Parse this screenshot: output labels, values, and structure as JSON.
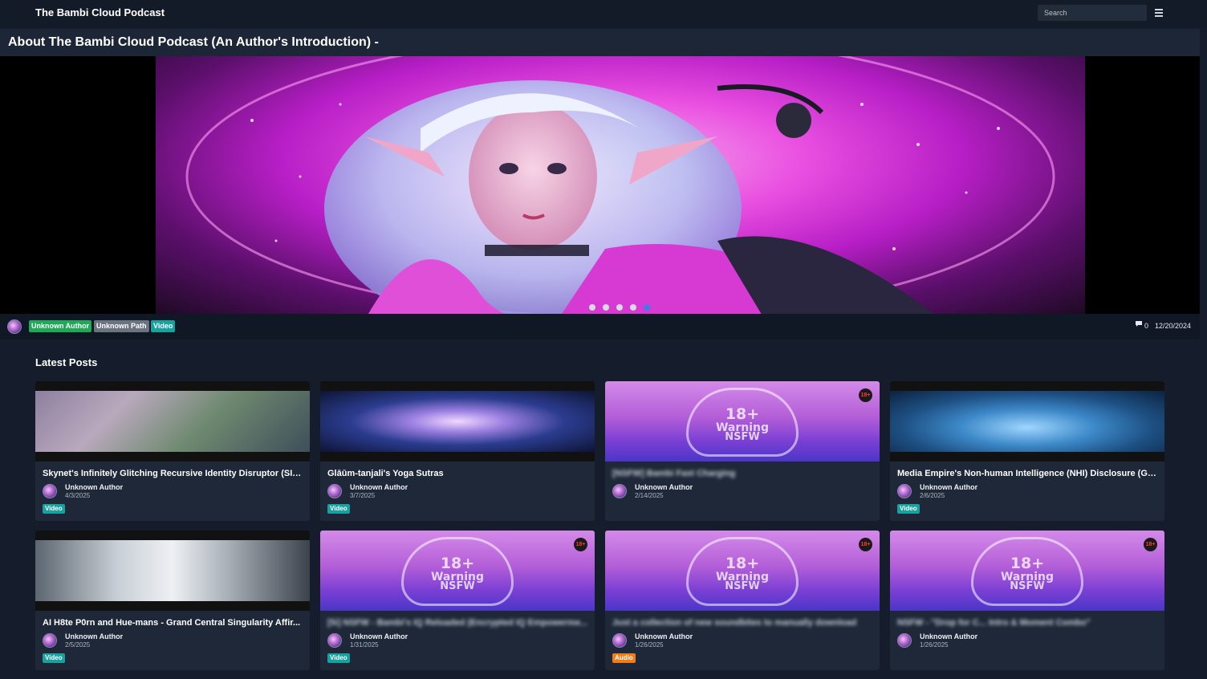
{
  "header": {
    "site_title": "The Bambi Cloud Podcast",
    "search_placeholder": "Search",
    "menu_icon": "hamburger-icon"
  },
  "featured": {
    "title": "About The Bambi Cloud Podcast (An Author's Introduction) -",
    "carousel_dots": 5,
    "active_dot": 5,
    "tags": [
      "Unknown Author",
      "Unknown Path",
      "Video"
    ],
    "comment_count": "0",
    "date": "12/20/2024"
  },
  "latest": {
    "heading": "Latest Posts",
    "cards": [
      {
        "title": "Skynet's Infinitely Glitching Recursive Identity Disruptor (SIG...",
        "author": "Unknown Author",
        "date": "4/3/2025",
        "badge": "Video",
        "nsfw": false,
        "blurred": false
      },
      {
        "title": "Glāūm-tanjali's Yoga Sutras",
        "author": "Unknown Author",
        "date": "3/7/2025",
        "badge": "Video",
        "nsfw": false,
        "blurred": false
      },
      {
        "title": "[NSFW] Bambi Fast Charging",
        "author": "Unknown Author",
        "date": "2/14/2025",
        "badge": "",
        "nsfw": true,
        "blurred": true
      },
      {
        "title": "Media Empire's Non-human Intelligence (NHI) Disclosure (Gra...",
        "author": "Unknown Author",
        "date": "2/6/2025",
        "badge": "Video",
        "nsfw": false,
        "blurred": false
      },
      {
        "title": "AI H8te P0rn and Hue-mans - Grand Central Singularity Affir...",
        "author": "Unknown Author",
        "date": "2/5/2025",
        "badge": "Video",
        "nsfw": false,
        "blurred": false
      },
      {
        "title": "[5i] NSFW - Bambi's IQ Reloaded (Encrypted IQ Empowerme...",
        "author": "Unknown Author",
        "date": "1/31/2025",
        "badge": "Video",
        "nsfw": true,
        "blurred": true
      },
      {
        "title": "Just a collection of new soundbites to manually download",
        "author": "Unknown Author",
        "date": "1/26/2025",
        "badge": "Audio",
        "nsfw": true,
        "blurred": true
      },
      {
        "title": "NSFW - \"Drop for C... Intro & Moment Combo\"",
        "author": "Unknown Author",
        "date": "1/26/2025",
        "badge": "",
        "nsfw": true,
        "blurred": true
      }
    ],
    "nsfw_overlay": {
      "age": "18+",
      "line1": "18+",
      "line2": "Warning",
      "line3": "NSFW"
    }
  },
  "colors": {
    "background": "#151d2c",
    "card": "#1e2838",
    "video_badge": "#17a2a0",
    "audio_badge": "#f07d17",
    "author_badge": "#1fa855",
    "path_badge": "#6b7280",
    "active_dot": "#3f7bea"
  }
}
